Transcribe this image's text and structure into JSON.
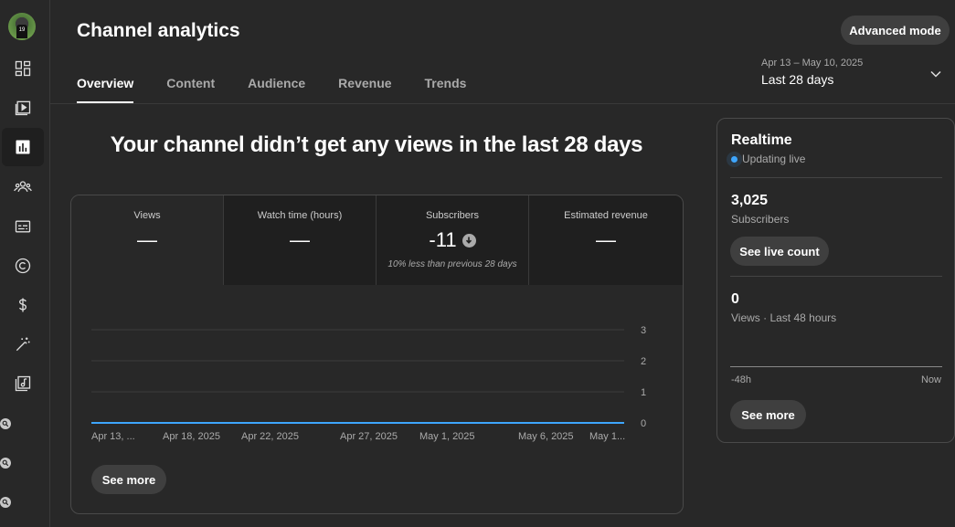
{
  "sidebar": {
    "items": [
      {
        "icon": "dashboard-icon"
      },
      {
        "icon": "content-icon"
      },
      {
        "icon": "analytics-icon",
        "active": true
      },
      {
        "icon": "community-icon"
      },
      {
        "icon": "subtitles-icon"
      },
      {
        "icon": "copyright-icon"
      },
      {
        "icon": "earn-icon"
      },
      {
        "icon": "customization-icon"
      },
      {
        "icon": "audio-library-icon"
      }
    ],
    "avatar_jersey": "19"
  },
  "header": {
    "title": "Channel analytics",
    "advanced_mode": "Advanced mode",
    "tabs": [
      {
        "label": "Overview",
        "active": true
      },
      {
        "label": "Content"
      },
      {
        "label": "Audience"
      },
      {
        "label": "Revenue"
      },
      {
        "label": "Trends"
      }
    ],
    "date_range": {
      "range": "Apr 13 – May 10, 2025",
      "label": "Last 28 days"
    }
  },
  "main": {
    "headline": "Your channel didn’t get any views in the last 28 days",
    "metrics": [
      {
        "label": "Views",
        "value": "—"
      },
      {
        "label": "Watch time (hours)",
        "value": "—"
      },
      {
        "label": "Subscribers",
        "value": "-11",
        "note": "10% less than previous 28 days"
      },
      {
        "label": "Estimated revenue",
        "value": "—"
      }
    ],
    "see_more": "See more"
  },
  "chart_data": {
    "type": "line",
    "x": [
      "Apr 13, ...",
      "Apr 18, 2025",
      "Apr 22, 2025",
      "Apr 27, 2025",
      "May 1, 2025",
      "May 6, 2025",
      "May 1..."
    ],
    "series": [
      {
        "values": [
          0,
          0,
          0,
          0,
          0,
          0,
          0
        ],
        "color": "#3ea6ff"
      }
    ],
    "y_ticks": [
      "3",
      "2",
      "1",
      "0"
    ],
    "ylim": [
      0,
      3
    ],
    "grid": true
  },
  "realtime": {
    "title": "Realtime",
    "status": "Updating live",
    "subscribers_count": "3,025",
    "subscribers_label": "Subscribers",
    "see_live_count": "See live count",
    "views_count": "0",
    "views_label": "Views · Last 48 hours",
    "axis_start": "-48h",
    "axis_end": "Now",
    "see_more": "See more"
  },
  "colors": {
    "background": "#282828",
    "accent": "#3ea6ff"
  }
}
